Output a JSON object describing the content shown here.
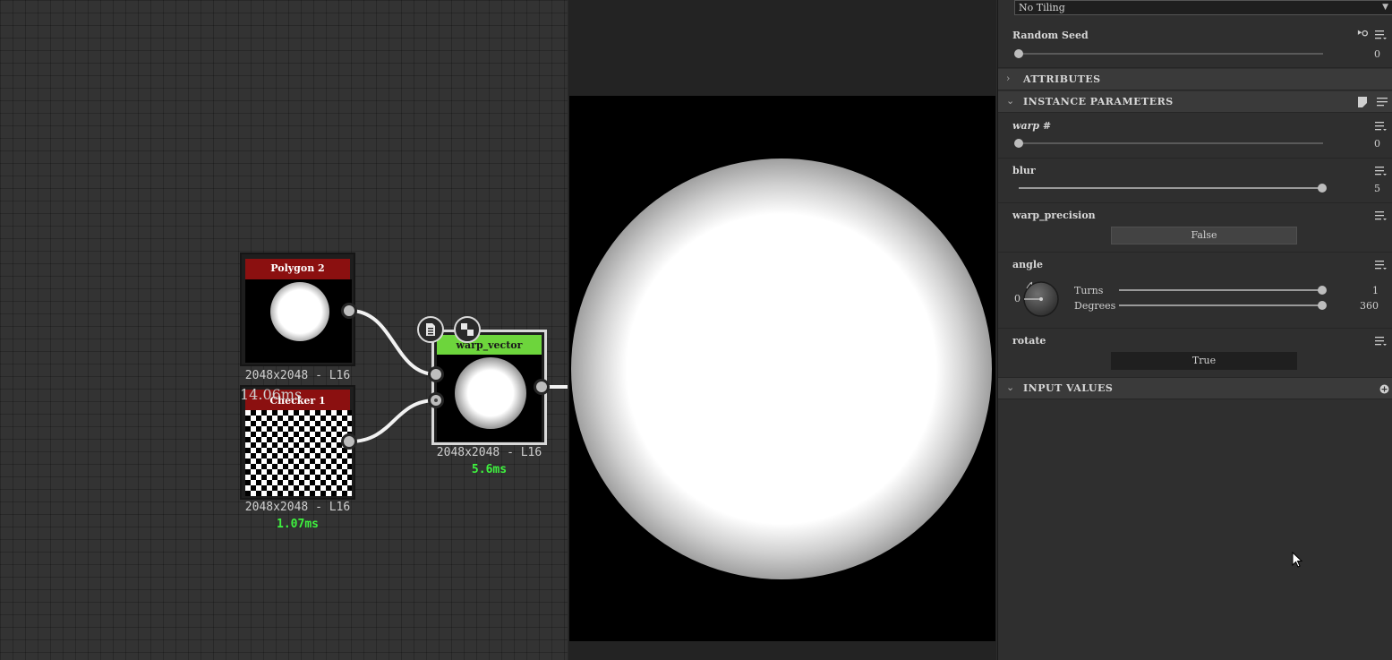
{
  "graph": {
    "nodes": [
      {
        "title": "Polygon 2",
        "resolution": "2048x2048 - L16",
        "time": "14.06ms",
        "header_color": "#8b1010"
      },
      {
        "title": "Checker 1",
        "resolution": "2048x2048 - L16",
        "time": "1.07ms",
        "header_color": "#8b1010"
      },
      {
        "title": "warp_vector",
        "resolution": "2048x2048 - L16",
        "time": "5.6ms",
        "header_color": "#6dd53c"
      }
    ],
    "overlay_icons": [
      "document-icon",
      "checker-icon"
    ]
  },
  "properties": {
    "tiling_dropdown": "No Tiling",
    "random_seed": {
      "label": "Random Seed",
      "value": "0",
      "fraction": 0
    },
    "sections": {
      "attributes": "ATTRIBUTES",
      "instance_parameters": "INSTANCE PARAMETERS",
      "input_values": "INPUT VALUES"
    },
    "params": {
      "warp": {
        "label": "warp #",
        "value": "0",
        "fraction": 0
      },
      "blur": {
        "label": "blur",
        "value": "5",
        "fraction": 1
      },
      "warp_precision": {
        "label": "warp_precision",
        "button": "False"
      },
      "angle": {
        "label": "angle",
        "dial_value": "0",
        "turns": {
          "label": "Turns",
          "value": "1",
          "fraction": 1
        },
        "degrees": {
          "label": "Degrees",
          "value": "360",
          "fraction": 1
        }
      },
      "rotate": {
        "label": "rotate",
        "button": "True"
      }
    }
  },
  "colors": {
    "output_ok": "#3ef23e",
    "node_error": "#8b1010",
    "node_active": "#6dd53c"
  }
}
